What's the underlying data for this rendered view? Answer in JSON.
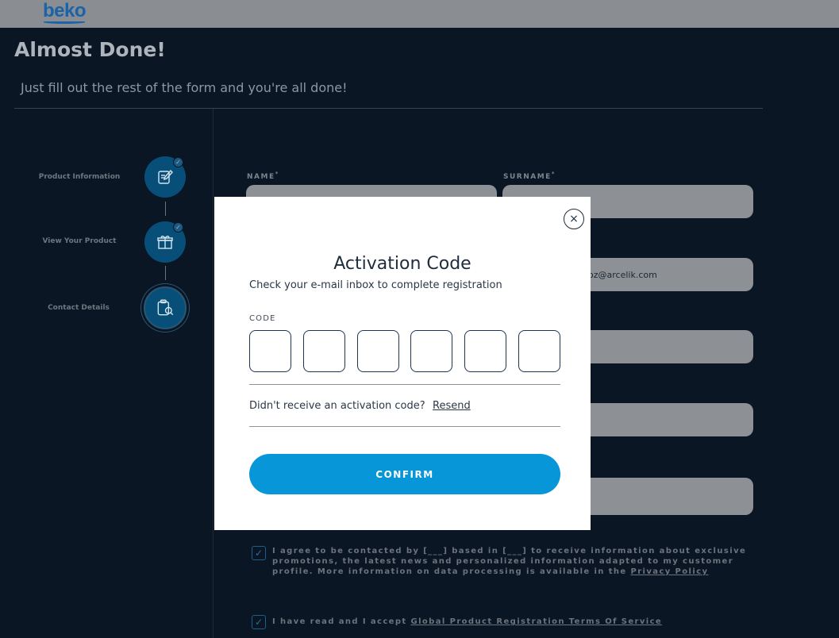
{
  "header": {
    "logo": "beko"
  },
  "page": {
    "title": "Almost Done!",
    "subtitle": "Just fill out the rest of the form and you're all done!"
  },
  "stepper": {
    "steps": [
      {
        "label": "Product Information",
        "icon": "edit-document-icon",
        "completed": true
      },
      {
        "label": "View Your Product",
        "icon": "gift-icon",
        "completed": true
      },
      {
        "label": "Contact Details",
        "icon": "clipboard-search-icon",
        "completed": false
      }
    ]
  },
  "form": {
    "name_label": "NAME",
    "surname_label": "SURNAME",
    "required_mark": "*",
    "email_value_fragment": "oz@arcelik.com"
  },
  "consents": [
    {
      "checked": true,
      "text_before": "I agree to be contacted by [___] based in [___] to receive information about exclusive promotions, the latest news and personalized information adapted to my customer profile. More information on data processing is available in the ",
      "link": "Privacy Policy"
    },
    {
      "checked": true,
      "text_before": "I have read and I accept ",
      "link": "Global Product Registration Terms Of Service"
    }
  ],
  "modal": {
    "title": "Activation Code",
    "subtitle": "Check your e-mail inbox to complete registration",
    "code_label": "CODE",
    "resend_prompt": "Didn't receive an activation code?",
    "resend_link": "Resend",
    "confirm_label": "CONFIRM",
    "close_symbol": "×"
  },
  "colors": {
    "accent": "#0796d8",
    "brand": "#1b63a8",
    "step_circle": "#074f78"
  }
}
